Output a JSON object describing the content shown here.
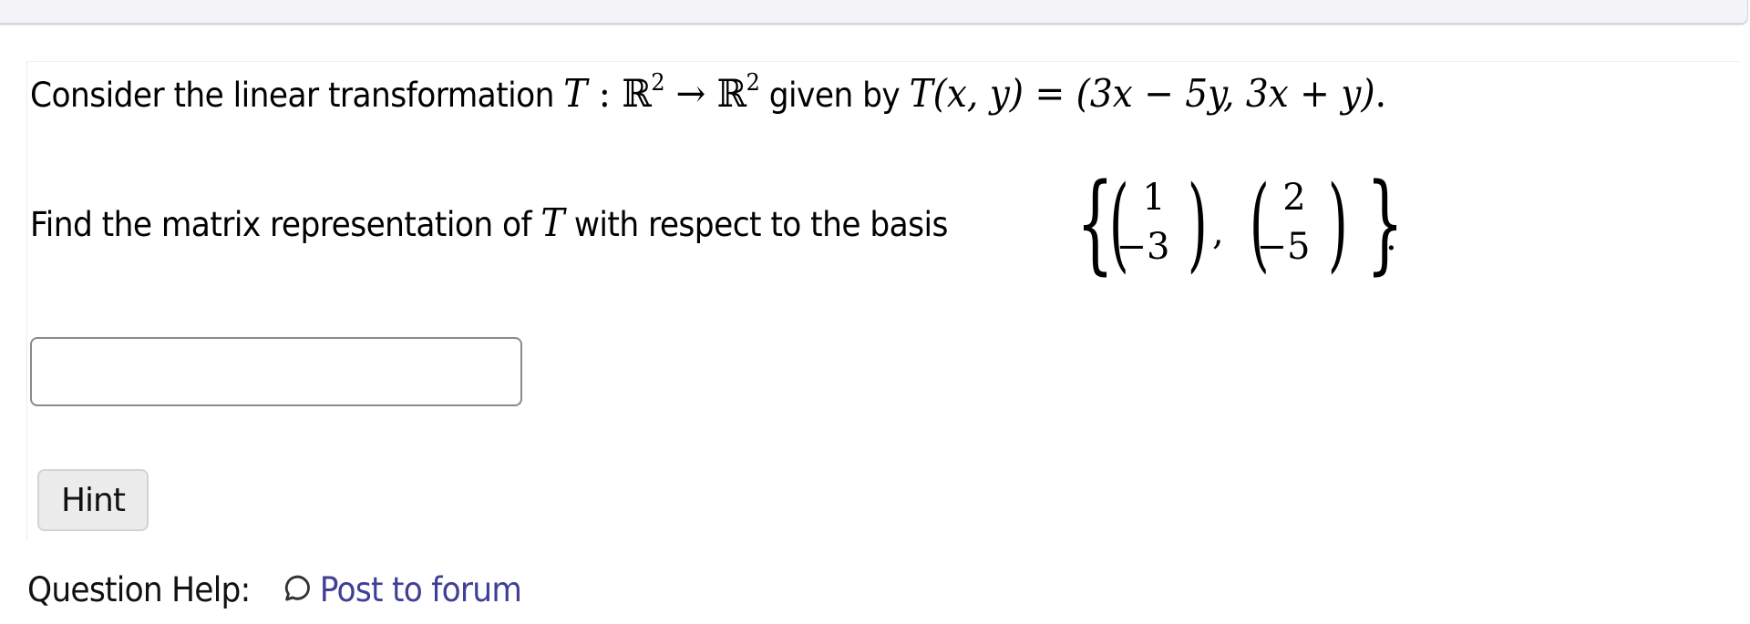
{
  "topbar": {},
  "question": {
    "line1": {
      "prefix": "Consider the linear transformation ",
      "map_T": "T",
      "colon": " : ",
      "domain_set": "ℝ",
      "domain_exp": "2",
      "arrow": " → ",
      "codomain_set": "ℝ",
      "codomain_exp": "2",
      "middle": " given by ",
      "func": "T",
      "args": "(x, y)",
      "equals": " = ",
      "image": "(3x − 5y, 3x + y)",
      "period": "."
    },
    "line2": {
      "prefix": "Find the matrix representation of ",
      "var": "T",
      "suffix": " with respect to the basis ",
      "basis": {
        "open_brace": "{",
        "close_brace": "}",
        "vectors": [
          {
            "top": "1",
            "bottom": "−3"
          },
          {
            "top": "2",
            "bottom": "−5"
          }
        ],
        "separator": ",",
        "period": "."
      }
    }
  },
  "answer": {
    "value": "",
    "placeholder": ""
  },
  "hint": {
    "label": "Hint"
  },
  "help": {
    "label": "Question Help:",
    "icon": "speech-bubble-icon",
    "link_text": "Post to forum",
    "link_color": "#3f3f97"
  }
}
